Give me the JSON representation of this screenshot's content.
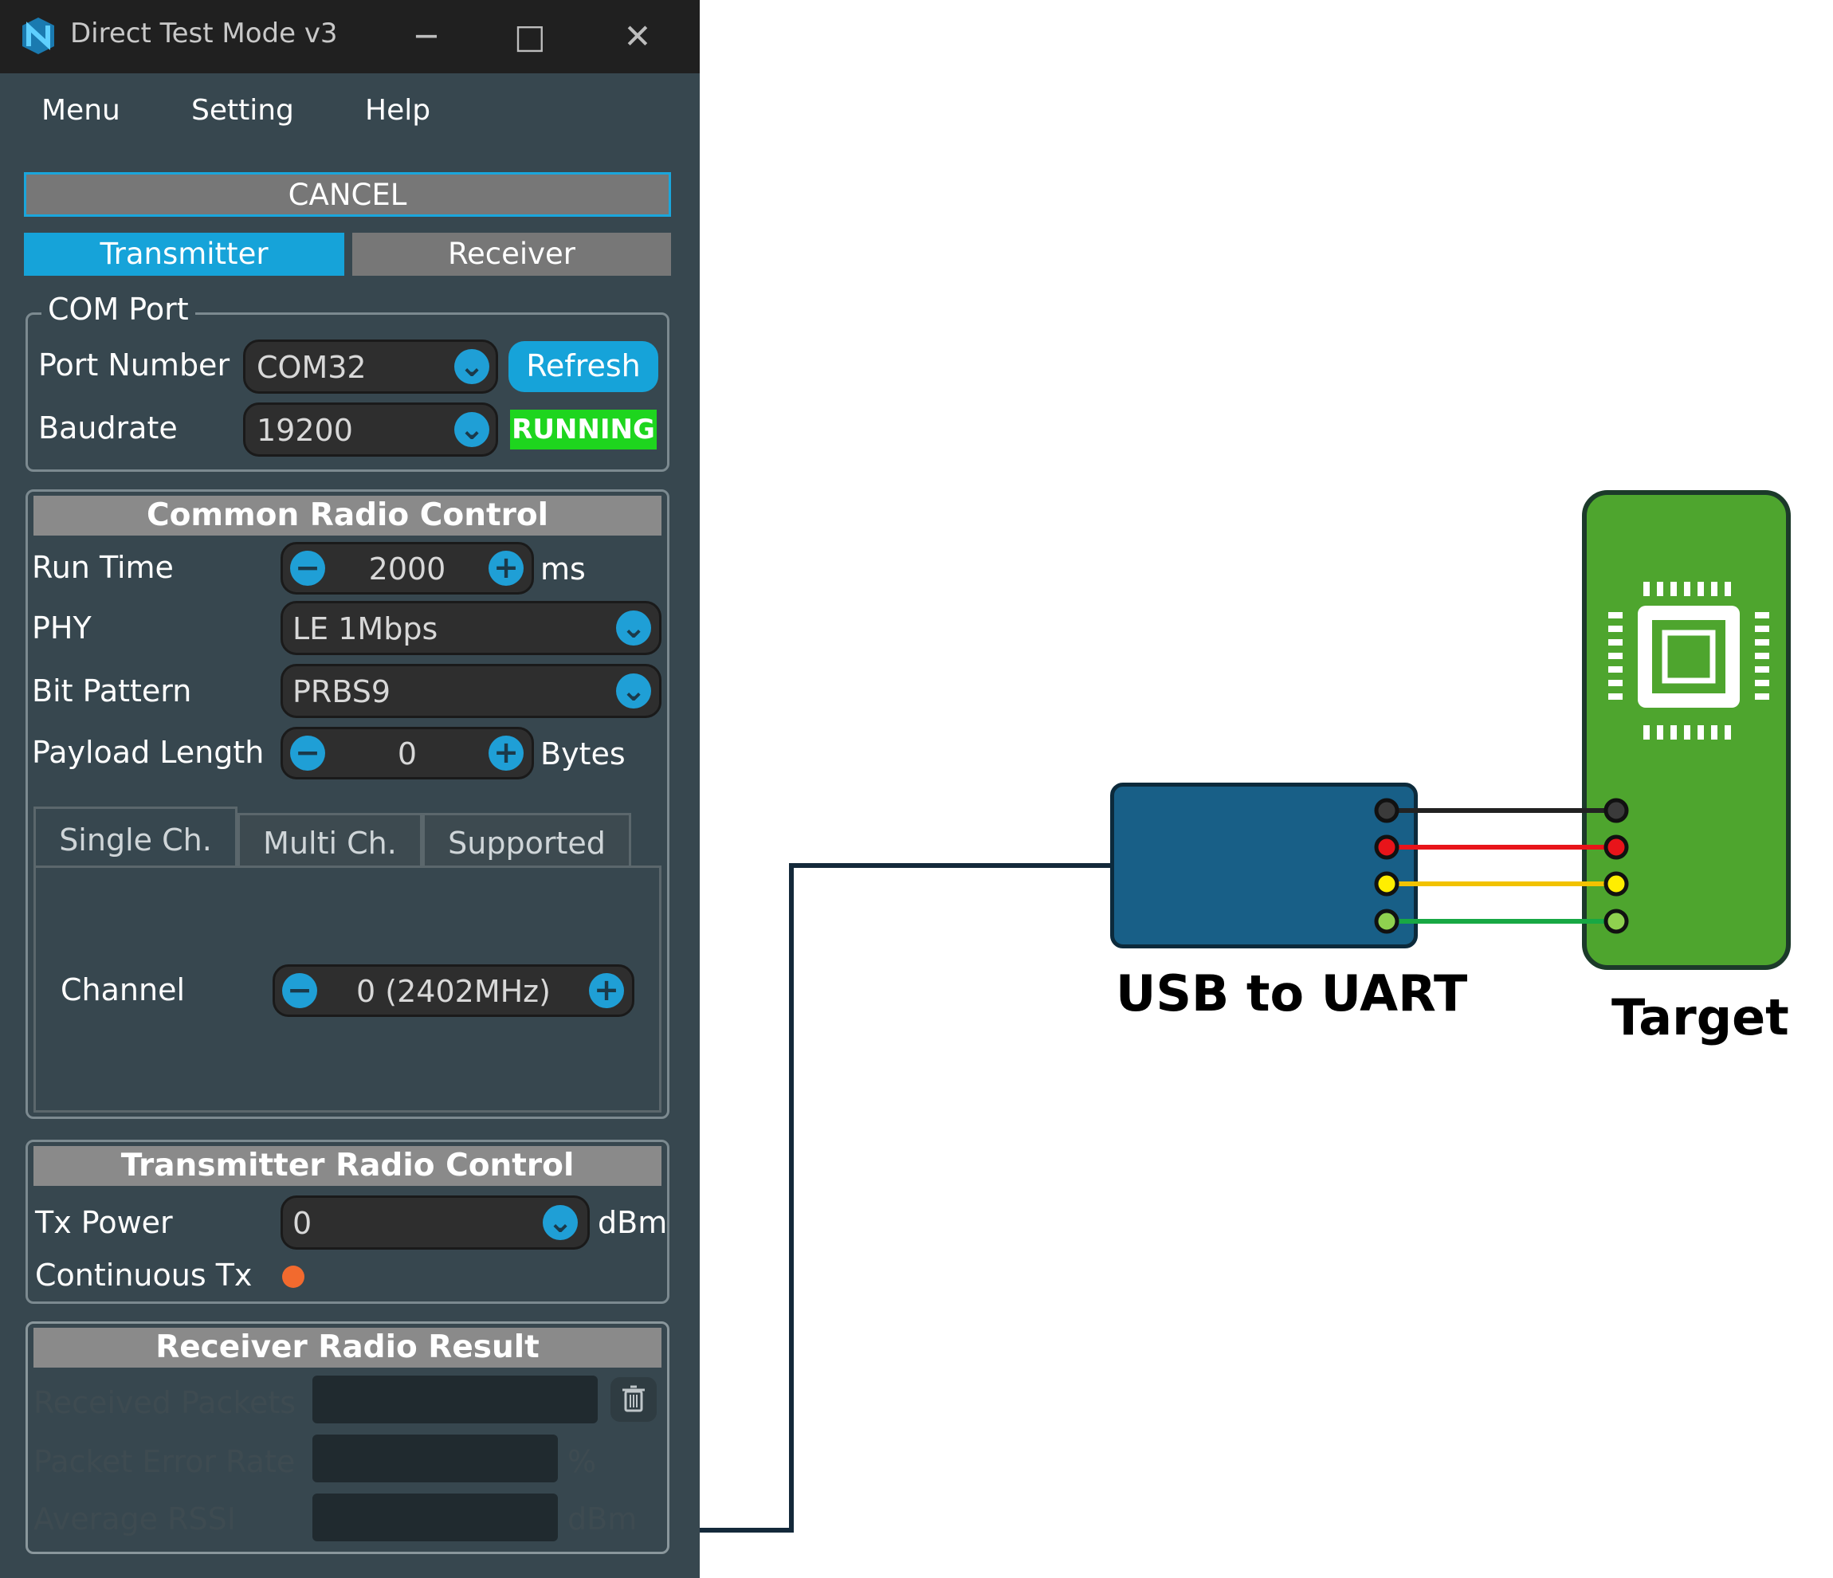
{
  "window": {
    "title": "Direct Test Mode v3",
    "controls": {
      "minimize": "─",
      "maximize": "□",
      "close": "✕"
    }
  },
  "menu": {
    "items": [
      "Menu",
      "Setting",
      "Help"
    ]
  },
  "cancel_label": "CANCEL",
  "mode_tabs": {
    "transmitter": "Transmitter",
    "receiver": "Receiver",
    "active": "Transmitter"
  },
  "com_port": {
    "group_title": "COM Port",
    "port_label": "Port Number",
    "port_value": "COM32",
    "refresh_label": "Refresh",
    "baud_label": "Baudrate",
    "baud_value": "19200",
    "status": "RUNNING"
  },
  "common_radio": {
    "title": "Common Radio Control",
    "run_time_label": "Run Time",
    "run_time_value": "2000",
    "run_time_unit": "ms",
    "phy_label": "PHY",
    "phy_value": "LE 1Mbps",
    "bit_pattern_label": "Bit Pattern",
    "bit_pattern_value": "PRBS9",
    "payload_label": "Payload Length",
    "payload_value": "0",
    "payload_unit": "Bytes",
    "channel_tabs": [
      "Single Ch.",
      "Multi Ch.",
      "Supported"
    ],
    "channel_label": "Channel",
    "channel_value": "0 (2402MHz)"
  },
  "tx_radio": {
    "title": "Transmitter Radio Control",
    "tx_power_label": "Tx Power",
    "tx_power_value": "0",
    "tx_power_unit": "dBm",
    "continuous_label": "Continuous Tx"
  },
  "rx_result": {
    "title": "Receiver Radio Result",
    "received_label": "Received Packets",
    "per_label": "Packet Error Rate",
    "per_unit": "%",
    "rssi_label": "Average RSSI",
    "rssi_unit": "dBm"
  },
  "diagram": {
    "usb_caption": "USB to UART",
    "target_caption": "Target",
    "wire_colors": [
      "#222222",
      "#e8141a",
      "#f2c200",
      "#18a844"
    ],
    "pin_colors": [
      "#3a3a3a",
      "#e8141a",
      "#ffee00",
      "#8fd14f"
    ],
    "icons": [
      "chip-icon"
    ]
  }
}
